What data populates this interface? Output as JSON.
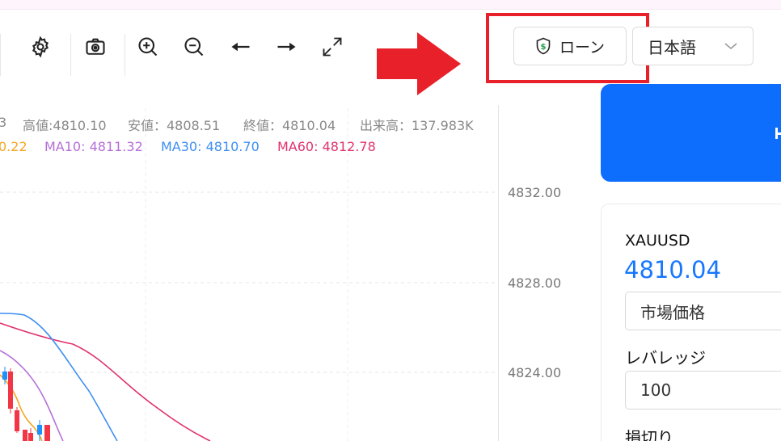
{
  "toolbar": {
    "icons": [
      "gear-icon",
      "camera-icon",
      "zoom-in-icon",
      "zoom-out-icon",
      "arrow-left-icon",
      "arrow-right-icon",
      "expand-icon"
    ]
  },
  "header": {
    "loan_label": "ローン",
    "language_selected": "日本語"
  },
  "colors": {
    "accent": "#0d6efd",
    "price_blue": "#1677ff",
    "annotation_red": "#e8202a",
    "candle_up": "#1e90ff",
    "candle_down": "#f23645",
    "ma5": "#f5a623",
    "ma10": "#b56fd8",
    "ma30": "#3d8ff2",
    "ma60": "#e0326e"
  },
  "chart": {
    "ohlc": {
      "open_fragment": "3",
      "high": "高値:4810.10",
      "low": "安値：4808.51",
      "close": "終値：4810.04",
      "volume": "出来高：137.983K"
    },
    "ma": {
      "ma5_fragment": "0.22",
      "ma10": "MA10: 4811.32",
      "ma30": "MA30: 4810.70",
      "ma60": "MA60: 4812.78"
    },
    "yticks": [
      "4832.00",
      "4828.00",
      "4824.00"
    ]
  },
  "order_panel": {
    "symbol": "XAUUSD",
    "price": "4810.04",
    "order_type": "市場価格",
    "leverage_label": "レバレッジ",
    "leverage_value": "100",
    "stop_loss_label": "損切り"
  },
  "chart_data": {
    "type": "line",
    "y_visible_ticks": [
      4832,
      4828,
      4824
    ],
    "series": [
      {
        "name": "MA10",
        "values": [
          4811.32
        ]
      },
      {
        "name": "MA30",
        "values": [
          4810.7
        ]
      },
      {
        "name": "MA60",
        "values": [
          4812.78
        ]
      }
    ]
  }
}
